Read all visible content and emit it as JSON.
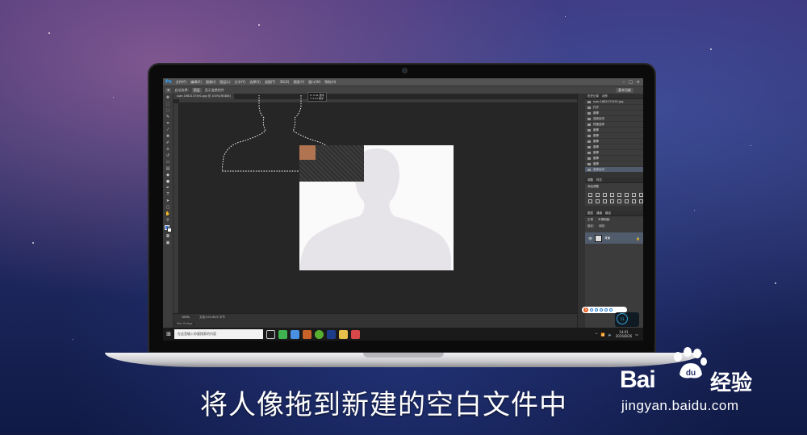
{
  "caption": "将人像拖到新建的空白文件中",
  "watermark": {
    "brand_left": "Bai",
    "brand_right": "经验",
    "url": "jingyan.baidu.com"
  },
  "photoshop": {
    "logo": "Ps",
    "menus": [
      "文件(F)",
      "编辑(E)",
      "图像(I)",
      "图层(L)",
      "文字(Y)",
      "选择(S)",
      "滤镜(T)",
      "3D(D)",
      "视图(V)",
      "窗口(W)",
      "帮助(H)"
    ],
    "options": {
      "auto_select": "自动选择:",
      "layer": "图层",
      "show_transform": "显示变换控件",
      "workspace": "基本功能"
    },
    "document_tab": "user-1662137491.jpg @ 100%(RGB/8)",
    "transform_info": [
      "X: 2.41 厘米",
      "Y: 2.21 厘米"
    ],
    "status_zoom": "100%",
    "status_doc": "文档:292.6K/0 字节",
    "mini_bridge": "Mini Bridge",
    "panels": {
      "history_tabs": [
        "历史记录",
        "动作"
      ],
      "history_file": "user-1662137491.jpg",
      "history_items": [
        {
          "label": "打开",
          "selected": false
        },
        {
          "label": "魔棒",
          "selected": false
        },
        {
          "label": "选择反向",
          "selected": false
        },
        {
          "label": "快速选择",
          "selected": false
        },
        {
          "label": "魔棒",
          "selected": false
        },
        {
          "label": "魔棒",
          "selected": false
        },
        {
          "label": "魔棒",
          "selected": false
        },
        {
          "label": "魔棒",
          "selected": false
        },
        {
          "label": "魔棒",
          "selected": false
        },
        {
          "label": "魔棒",
          "selected": false
        },
        {
          "label": "魔棒",
          "selected": false
        },
        {
          "label": "选择反向",
          "selected": true
        }
      ],
      "adjust_tabs": [
        "调整",
        "样式"
      ],
      "adjust_title": "添加调整",
      "layers_tabs": [
        "图层",
        "通道",
        "路径"
      ],
      "layers_mode": "正常",
      "layers_opacity": "不透明度:",
      "layers_lock": "锁定:",
      "layers_fill": "填充:",
      "layer_name": "背景"
    }
  },
  "taskbar": {
    "search_placeholder": "在这里输入你要搜索的内容",
    "clock_time": "14:01",
    "clock_date": "2016/8/26",
    "net_value": "53"
  }
}
